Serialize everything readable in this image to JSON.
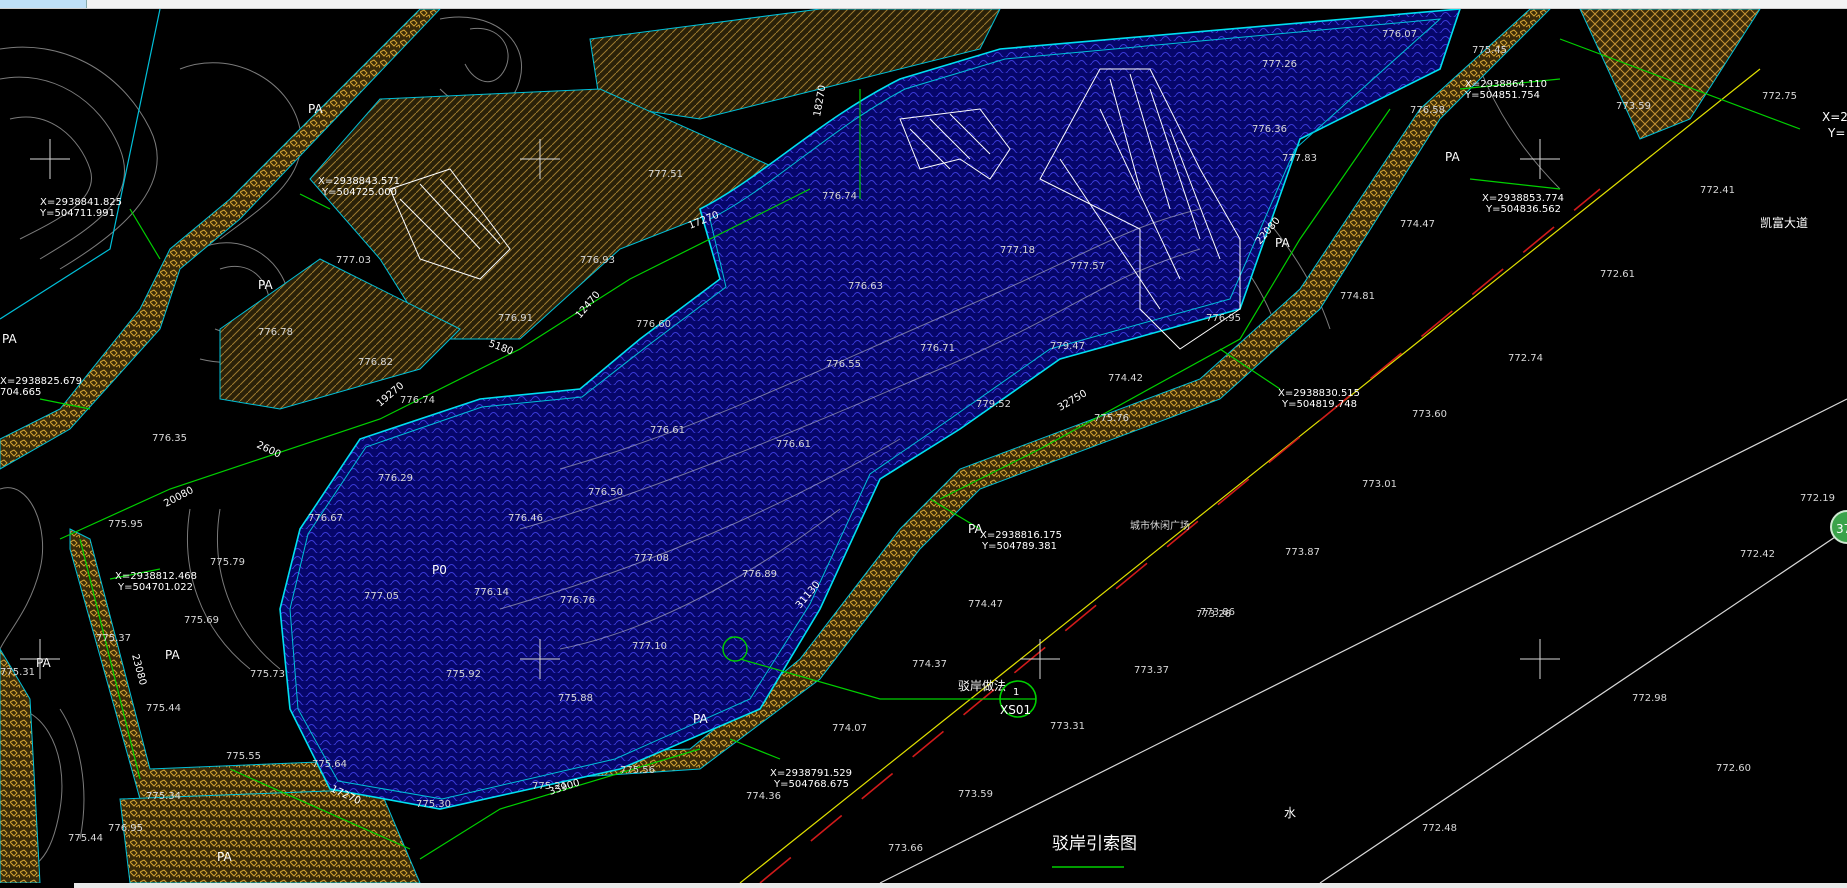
{
  "drawing": {
    "title": "驳岸引索图",
    "detail_callout": {
      "label": "驳岸做法",
      "number": "1",
      "sheet": "XS01"
    },
    "pool_label": "P0",
    "zone_label": "PA",
    "road_label": "凯富大道",
    "plaza_label": "城市休闲广场",
    "corner_label": "X=2",
    "corner_label_2": "Y=",
    "misc_label": "水",
    "badge_number": "37"
  },
  "coordinates": [
    {
      "x": "X=2938841.825",
      "y": "Y=504711.991"
    },
    {
      "x": "X=2938843.571",
      "y": "Y=504725.000"
    },
    {
      "x": "X=2938825.679",
      "y": "704.665"
    },
    {
      "x": "X=2938812.468",
      "y": "Y=504701.022"
    },
    {
      "x": "X=2938864.110",
      "y": "Y=504851.754"
    },
    {
      "x": "X=2938853.774",
      "y": "Y=504836.562"
    },
    {
      "x": "X=2938830.515",
      "y": "Y=504819.748"
    },
    {
      "x": "X=2938816.175",
      "y": "Y=504789.381"
    },
    {
      "x": "X=2938791.529",
      "y": "Y=504768.675"
    }
  ],
  "dimensions": [
    "17270",
    "12470",
    "5180",
    "19270",
    "2600",
    "20080",
    "23080",
    "17270",
    "33900",
    "31130",
    "32750",
    "22080",
    "18270"
  ],
  "elevations": [
    "776.07",
    "777.26",
    "775.45",
    "773.59",
    "772.75",
    "776.36",
    "776.58",
    "777.83",
    "777.18",
    "776.74",
    "776.63",
    "776.60",
    "776.55",
    "776.71",
    "777.57",
    "779.47",
    "779.52",
    "776.61",
    "776.61",
    "776.50",
    "776.46",
    "776.29",
    "776.67",
    "777.08",
    "777.05",
    "776.14",
    "776.76",
    "776.89",
    "777.10",
    "775.92",
    "775.88",
    "775.73",
    "775.64",
    "775.55",
    "775.30",
    "775.21",
    "775.56",
    "775.37",
    "775.44",
    "775.34",
    "775.31",
    "775.69",
    "775.79",
    "775.95",
    "777.03",
    "776.78",
    "776.82",
    "776.74",
    "776.35",
    "776.95",
    "777.51",
    "776.93",
    "776.91",
    "776.95",
    "774.47",
    "774.81",
    "772.41",
    "772.61",
    "772.74",
    "773.60",
    "773.01",
    "772.19",
    "772.42",
    "772.98",
    "773.87",
    "773.86",
    "773.37",
    "773.26",
    "773.31",
    "773.59",
    "773.66",
    "774.36",
    "774.37",
    "774.07",
    "774.47",
    "775.76",
    "775.44",
    "772.60",
    "772.48",
    "774.42"
  ]
}
